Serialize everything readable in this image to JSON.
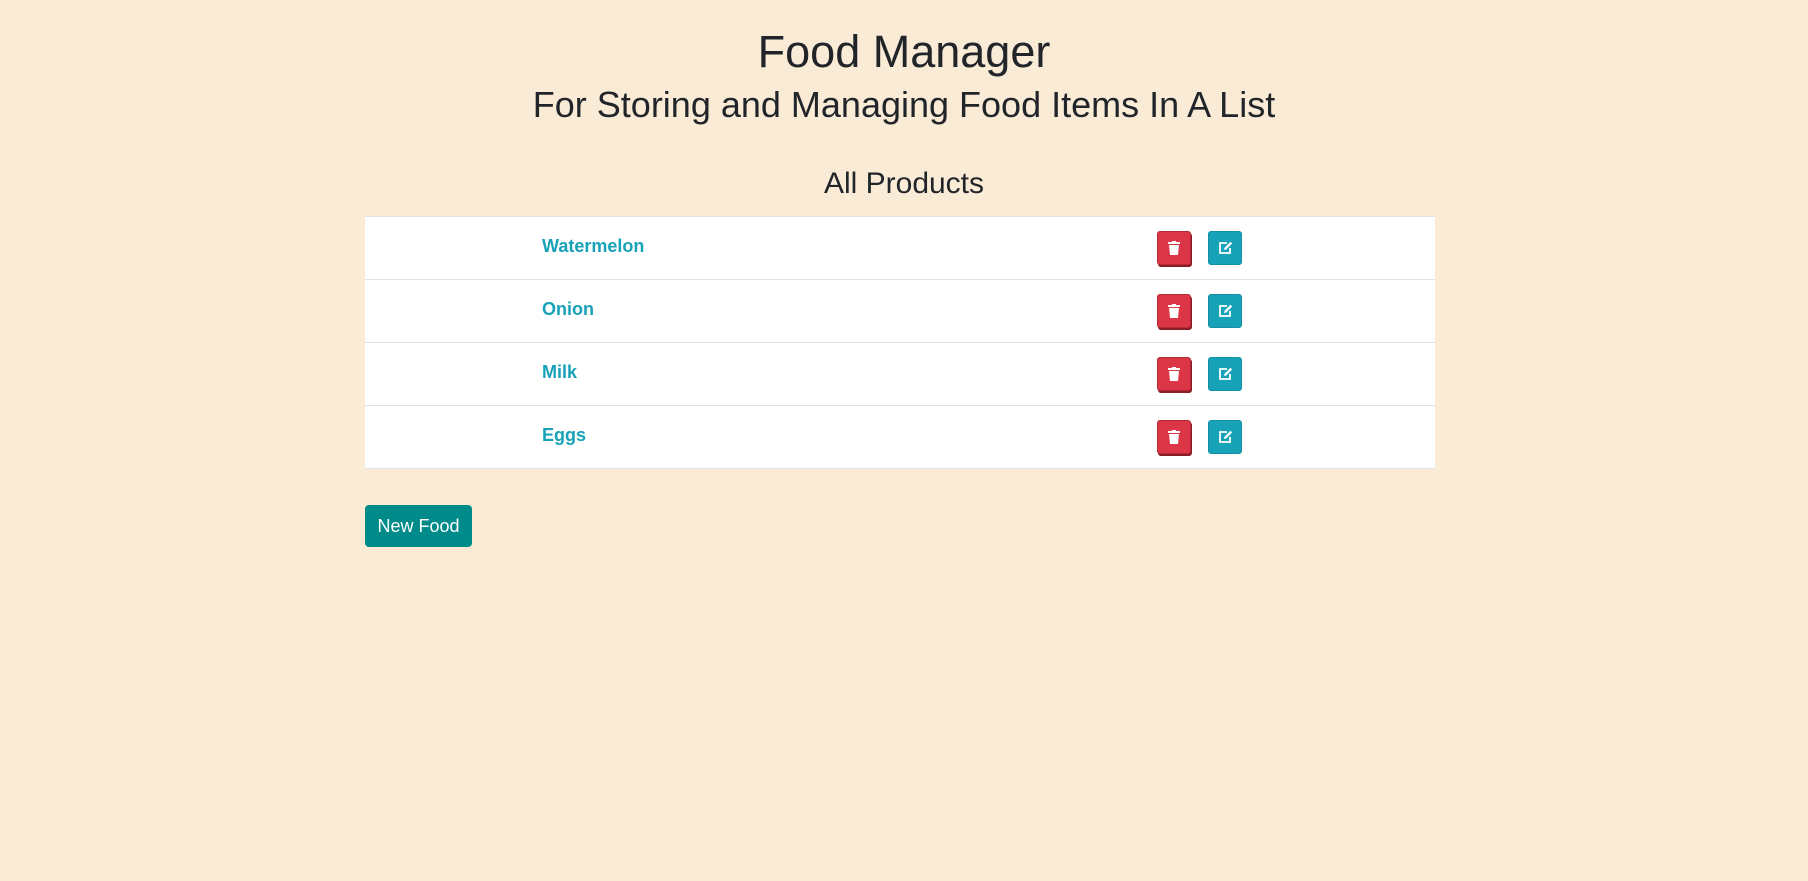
{
  "header": {
    "title": "Food Manager",
    "subtitle": "For Storing and Managing Food Items In A List"
  },
  "section": {
    "title": "All Products"
  },
  "products": [
    {
      "name": "Watermelon"
    },
    {
      "name": "Onion"
    },
    {
      "name": "Milk"
    },
    {
      "name": "Eggs"
    }
  ],
  "actions": {
    "new_food_label": "New Food",
    "delete_icon": "trash-icon",
    "edit_icon": "edit-icon"
  },
  "colors": {
    "background": "#faebd7",
    "item_text": "#17a2b8",
    "delete_button": "#dc3545",
    "edit_button": "#17a2b8",
    "new_food_button": "#008b8b"
  }
}
